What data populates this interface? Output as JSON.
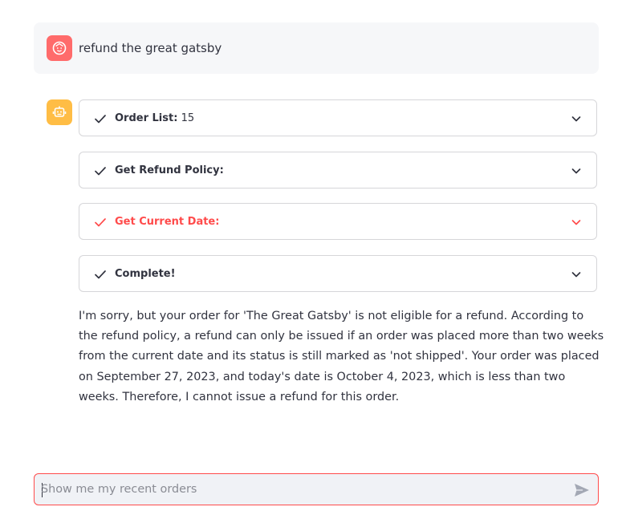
{
  "user_message": {
    "text": "refund the great gatsby",
    "avatar_icon": "user-face-icon",
    "avatar_color": "#ff6b6b"
  },
  "assistant": {
    "avatar_icon": "robot-icon",
    "avatar_color": "#ffbd45",
    "steps": [
      {
        "label": "Order List:",
        "value": "15",
        "status": "complete"
      },
      {
        "label": "Get Refund Policy:",
        "value": "",
        "status": "complete"
      },
      {
        "label": "Get Current Date:",
        "value": "",
        "status": "error"
      },
      {
        "label": "Complete!",
        "value": "",
        "status": "complete"
      }
    ],
    "answer": "I'm sorry, but your order for 'The Great Gatsby' is not eligible for a refund. According to the refund policy, a refund can only be issued if an order was placed more than two weeks from the current date and its status is still marked as 'not shipped'. Your order was placed on September 27, 2023, and today's date is October 4, 2023, which is less than two weeks. Therefore, I cannot issue a refund for this order."
  },
  "chat_input": {
    "placeholder": "Show me my recent orders",
    "value": "",
    "send_icon": "send-icon"
  },
  "colors": {
    "error": "#ff4b4b",
    "text": "#31333f",
    "border": "#d6d6d9"
  }
}
